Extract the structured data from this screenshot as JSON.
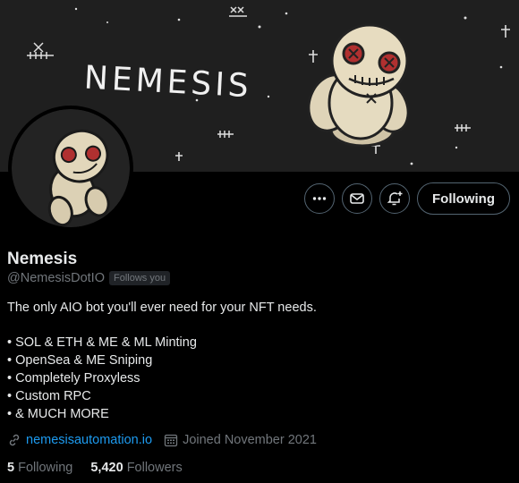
{
  "banner": {
    "title_art": "NEMESIS"
  },
  "actions": {
    "more_icon": "more-dots-icon",
    "message_icon": "envelope-icon",
    "notify_icon": "bell-plus-icon",
    "following_label": "Following"
  },
  "profile": {
    "name": "Nemesis",
    "handle": "@NemesisDotIO",
    "follows_you": "Follows you",
    "bio": {
      "intro": "The only AIO bot you'll ever need for your NFT needs.",
      "bullets": [
        "• SOL & ETH & ME & ML Minting",
        "• OpenSea & ME Sniping",
        "• Completely Proxyless",
        "• Custom RPC",
        "• & MUCH MORE"
      ]
    },
    "website": "nemesisautomation.io",
    "joined": "Joined November 2021",
    "following_count": "5",
    "following_label": "Following",
    "followers_count": "5,420",
    "followers_label": "Followers"
  },
  "colors": {
    "accent": "#1d9bf0",
    "muted": "#71767b",
    "text": "#e7e9ea",
    "background": "#000000"
  }
}
